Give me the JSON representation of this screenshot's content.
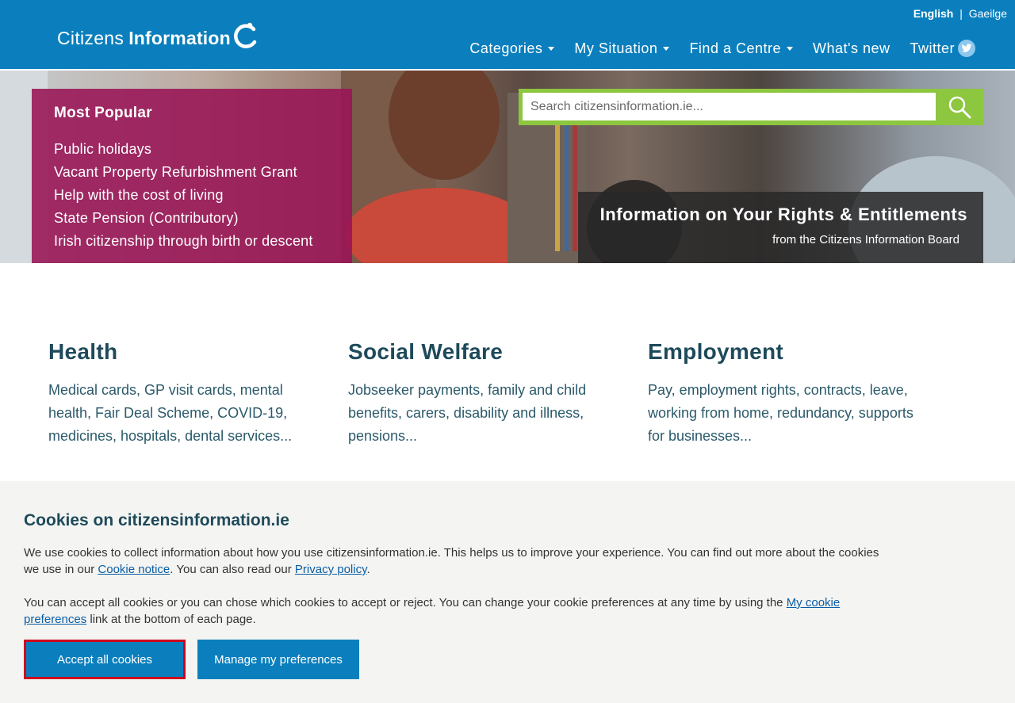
{
  "header": {
    "lang_active": "English",
    "lang_separator": "|",
    "lang_other": "Gaeilge",
    "logo_light": "Citizens",
    "logo_bold": "Information",
    "nav": [
      {
        "label": "Categories",
        "dropdown": true
      },
      {
        "label": "My Situation",
        "dropdown": true
      },
      {
        "label": "Find a Centre",
        "dropdown": true
      },
      {
        "label": "What's new",
        "dropdown": false
      },
      {
        "label": "Twitter",
        "dropdown": false
      }
    ]
  },
  "popular": {
    "title": "Most Popular",
    "items": [
      "Public holidays",
      "Vacant Property Refurbishment Grant",
      "Help with the cost of living",
      "State Pension (Contributory)",
      "Irish citizenship through birth or descent"
    ]
  },
  "search": {
    "placeholder": "Search citizensinformation.ie..."
  },
  "banner": {
    "title": "Information on Your Rights & Entitlements",
    "subtitle": "from the Citizens Information Board"
  },
  "categories": [
    {
      "title": "Health",
      "description": "Medical cards, GP visit cards, mental health, Fair Deal Scheme, COVID-19, medicines, hospitals, dental services..."
    },
    {
      "title": "Social Welfare",
      "description": "Jobseeker payments, family and child benefits, carers, disability and illness, pensions..."
    },
    {
      "title": "Employment",
      "description": "Pay, employment rights, contracts, leave, working from home, redundancy, supports for businesses..."
    }
  ],
  "cookie": {
    "title": "Cookies on citizensinformation.ie",
    "p1_before": "We use cookies to collect information about how you use citizensinformation.ie. This helps us to improve your experience. You can find out more about the cookies we use in our ",
    "p1_link1": "Cookie notice",
    "p1_middle": ". You can also read our ",
    "p1_link2": "Privacy policy",
    "p1_after": ".",
    "p2_before": "You can accept all cookies or you can chose which cookies to accept or reject. You can change your cookie preferences at any time by using the ",
    "p2_link": "My cookie preferences",
    "p2_after": " link at the bottom of each page.",
    "accept_label": "Accept all cookies",
    "manage_label": "Manage my preferences"
  },
  "colors": {
    "header_blue": "#0b7fbd",
    "popular_magenta": "#991355",
    "search_green": "#8dc63f",
    "heading_teal": "#1e4a5a",
    "accept_highlight": "#d0021b"
  }
}
